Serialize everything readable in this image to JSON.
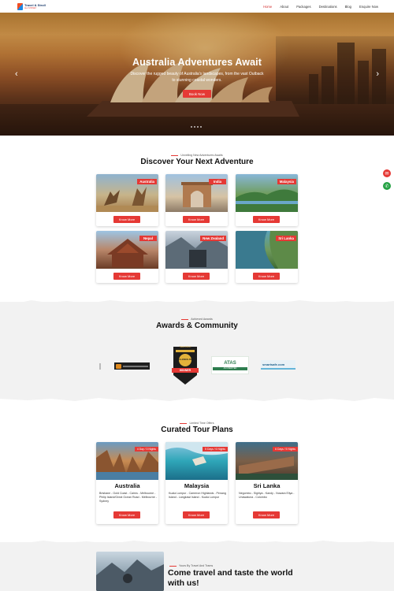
{
  "nav": {
    "logo_text": "Travel & Stroll",
    "logo_sub": "ALL SYDNEY",
    "menu": [
      "Home",
      "About",
      "Packages",
      "Destinations",
      "Blog",
      "Enquire Now"
    ]
  },
  "hero": {
    "title": "Australia Adventures Await",
    "subtitle": "Discover the rugged beauty of Australia's landscapes, from the vast Outback to stunning coastal wonders.",
    "button": "Book Now",
    "prev_icon": "chevron-left-icon",
    "next_icon": "chevron-right-icon"
  },
  "destinations": {
    "eyebrow": "Unveiling New Adventures Awaits",
    "title": "Discover Your Next Adventure",
    "button": "Know More",
    "items": [
      {
        "name": "Australia"
      },
      {
        "name": "India"
      },
      {
        "name": "Malaysia"
      },
      {
        "name": "Nepal"
      },
      {
        "name": "New Zealand"
      },
      {
        "name": "Sri Lanka"
      }
    ]
  },
  "awards": {
    "eyebrow": "Achieved Awards",
    "title": "Awards & Community",
    "badge_top": "Travel Advisor",
    "badge_main": "EXCELLENCE AWARD",
    "badge_winner": "WINNER",
    "atas": "ATAS",
    "atas_sub": "ACCREDITED",
    "smart": "smartsafe.com"
  },
  "tours": {
    "eyebrow": "Limited Time Offers",
    "title": "Curated Tour Plans",
    "button": "Know More",
    "items": [
      {
        "name": "Australia",
        "duration": "4 Day / 3 Nights",
        "route": "Brisbane - Gold Coast - Cairns - Melbourne - Philip Island/Great Ocean Road - Melbourne - Sydney"
      },
      {
        "name": "Malaysia",
        "duration": "5 Days / 6 Nights",
        "route": "Kuala Lumpur - Cameron Highlands - Penang Island - Langkawi Island - Kuala Lumpur"
      },
      {
        "name": "Sri Lanka",
        "duration": "6 Days / 5 Nights",
        "route": "Negombo - Sigiriya - Kandy - Nuwara Eliya - Unawatuna - Colombo"
      }
    ]
  },
  "about": {
    "eyebrow": "Yours By Travel And Trams",
    "title": "Come travel and taste the world with us!"
  },
  "floating": {
    "mail_icon": "mail-icon",
    "whatsapp_icon": "whatsapp-icon"
  }
}
